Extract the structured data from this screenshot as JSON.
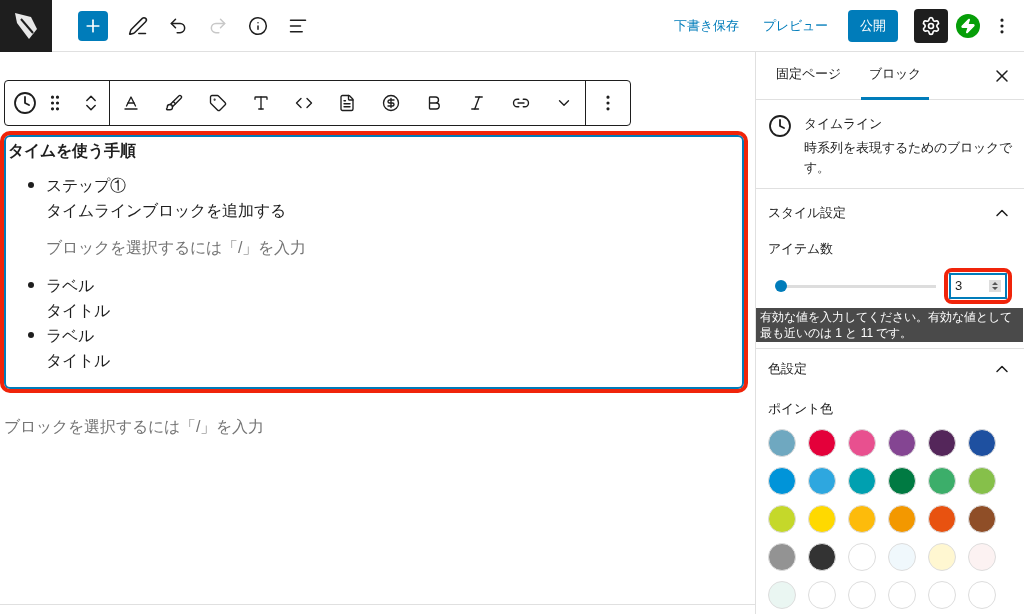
{
  "top_bar": {
    "actions": [
      "下書き保存",
      "プレビュー"
    ],
    "publish": "公開"
  },
  "editor": {
    "block": {
      "heading": "タイムを使う手順",
      "items": [
        {
          "kind": "item",
          "label": "ステップ①",
          "title": "タイムラインブロックを追加する"
        },
        {
          "kind": "hint",
          "text": "ブロックを選択するには「/」を入力"
        },
        {
          "kind": "item",
          "label": "ラベル",
          "title": "タイトル"
        },
        {
          "kind": "item",
          "label": "ラベル",
          "title": "タイトル"
        }
      ]
    },
    "appender": "ブロックを選択するには「/」を入力"
  },
  "sidebar": {
    "tabs": [
      {
        "label": "固定ページ",
        "selected": false
      },
      {
        "label": "ブロック",
        "selected": true
      }
    ],
    "block_card": {
      "title": "タイムライン",
      "description": "時系列を表現するためのブロックです。"
    },
    "panels": [
      {
        "title": "スタイル設定",
        "expanded": true
      },
      {
        "title": "色設定",
        "expanded": true
      }
    ],
    "item_count": {
      "label": "アイテム数",
      "level": 0.03,
      "value": "3",
      "tooltip": "有効な値を入力してください。有効な値として最も近いのは 1 と 11 です。"
    },
    "point_color": {
      "label": "ポイント色",
      "swatches": [
        {
          "color": "#6fa8c0"
        },
        {
          "color": "#e4003a"
        },
        {
          "color": "#e8508f"
        },
        {
          "color": "#844592"
        },
        {
          "color": "#54265a"
        },
        {
          "color": "#1e50a0"
        },
        {
          "color": "#0094d9"
        },
        {
          "color": "#2ea7df"
        },
        {
          "color": "#00a0b0"
        },
        {
          "color": "#007a42"
        },
        {
          "color": "#3cae6a"
        },
        {
          "color": "#86c04a"
        },
        {
          "color": "#c5d82a"
        },
        {
          "color": "#ffd900"
        },
        {
          "color": "#fdbb0b"
        },
        {
          "color": "#f39800"
        },
        {
          "color": "#e85210"
        },
        {
          "color": "#8f4e27"
        },
        {
          "color": "#939393"
        },
        {
          "color": "#333333"
        },
        {
          "color": "#ffffff"
        },
        {
          "color": "#f0f8fc"
        },
        {
          "color": "#fff7d1"
        },
        {
          "color": "#fcf2f2"
        },
        {
          "color": "#eaf6f2"
        },
        {
          "color": "#ffffff"
        },
        {
          "color": "#ffffff"
        },
        {
          "color": "#ffffff"
        },
        {
          "color": "#ffffff"
        },
        {
          "color": "#ffffff"
        }
      ]
    }
  }
}
